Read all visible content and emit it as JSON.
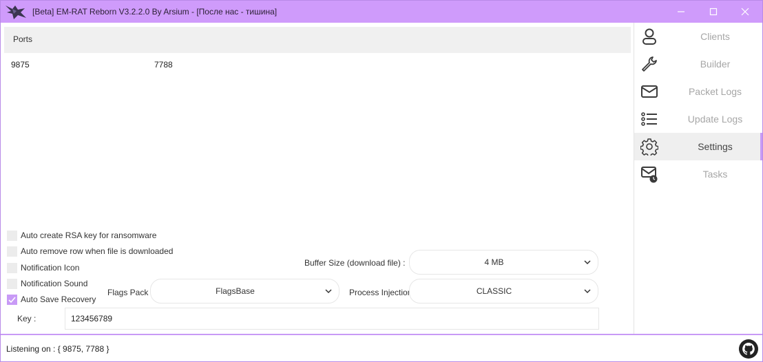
{
  "window": {
    "title": "[Beta] EM-RAT Reborn V3.2.2.0 By Arsium - [После нас - тишина]",
    "accent_color": "#c89af6",
    "titlebar_color": "#cf9bfb"
  },
  "ports": {
    "header": "Ports",
    "values": [
      "9875",
      "7788"
    ]
  },
  "options": {
    "auto_rsa": {
      "label": "Auto create RSA key for ransomware",
      "checked": false
    },
    "auto_remove": {
      "label": "Auto remove row when file is downloaded",
      "checked": false
    },
    "notification_icon": {
      "label": "Notification Icon",
      "checked": false
    },
    "notification_sound": {
      "label": "Notification Sound",
      "checked": false
    },
    "auto_save_recovery": {
      "label": "Auto Save Recovery",
      "checked": true
    }
  },
  "settings": {
    "buffer_label": "Buffer Size (download file) :",
    "buffer_value": "4 MB",
    "flags_label": "Flags Pack :",
    "flags_value": "FlagsBase",
    "injection_label": "Process Injection",
    "injection_value": "CLASSIC",
    "key_label": "Key :",
    "key_value": "123456789"
  },
  "sidebar": {
    "items": [
      {
        "label": "Clients",
        "icon": "user-icon",
        "active": false
      },
      {
        "label": "Builder",
        "icon": "wrench-icon",
        "active": false
      },
      {
        "label": "Packet Logs",
        "icon": "envelope-icon",
        "active": false
      },
      {
        "label": "Update Logs",
        "icon": "list-icon",
        "active": false
      },
      {
        "label": "Settings",
        "icon": "gear-icon",
        "active": true
      },
      {
        "label": "Tasks",
        "icon": "scheduled-mail-icon",
        "active": false
      }
    ]
  },
  "status": {
    "text": "Listening on : { 9875, 7788 }"
  }
}
